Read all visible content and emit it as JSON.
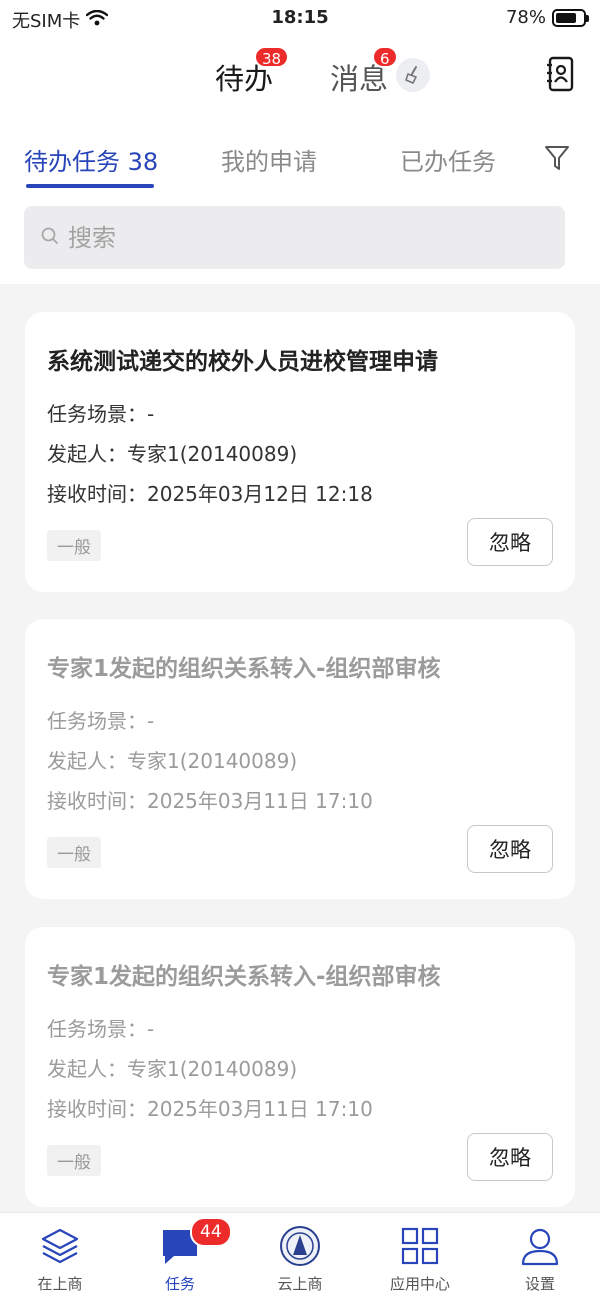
{
  "status_bar": {
    "carrier": "无SIM卡",
    "time": "18:15",
    "battery_text": "78%",
    "battery_level": 0.78
  },
  "header": {
    "tab_todo": "待办",
    "todo_badge": "38",
    "tab_messages": "消息",
    "messages_badge": "6"
  },
  "tabs": {
    "pending": "待办任务 38",
    "my_requests": "我的申请",
    "done": "已办任务"
  },
  "search": {
    "placeholder": "搜索"
  },
  "cards": [
    {
      "title": "系统测试递交的校外人员进校管理申请",
      "scene": "任务场景：-",
      "initiator": "发起人：专家1(20140089)",
      "received": "接收时间：2025年03月12日 12:18",
      "tag": "一般",
      "button": "忽略"
    },
    {
      "title": "专家1发起的组织关系转入-组织部审核",
      "scene": "任务场景：-",
      "initiator": "发起人：专家1(20140089)",
      "received": "接收时间：2025年03月11日 17:10",
      "tag": "一般",
      "button": "忽略"
    },
    {
      "title": "专家1发起的组织关系转入-组织部审核",
      "scene": "任务场景：-",
      "initiator": "发起人：专家1(20140089)",
      "received": "接收时间：2025年03月11日 17:10",
      "tag": "一般",
      "button": "忽略"
    }
  ],
  "bottom_nav": [
    {
      "label": "在上商",
      "icon": "layers-icon"
    },
    {
      "label": "任务",
      "icon": "chat-bubble-icon",
      "badge": "44"
    },
    {
      "label": "云上商",
      "icon": "school-logo-icon"
    },
    {
      "label": "应用中心",
      "icon": "grid-apps-icon"
    },
    {
      "label": "设置",
      "icon": "user-icon"
    }
  ],
  "colors": {
    "accent": "#2845b9",
    "badge": "#ee2b2b",
    "background": "#f4f4f5"
  }
}
